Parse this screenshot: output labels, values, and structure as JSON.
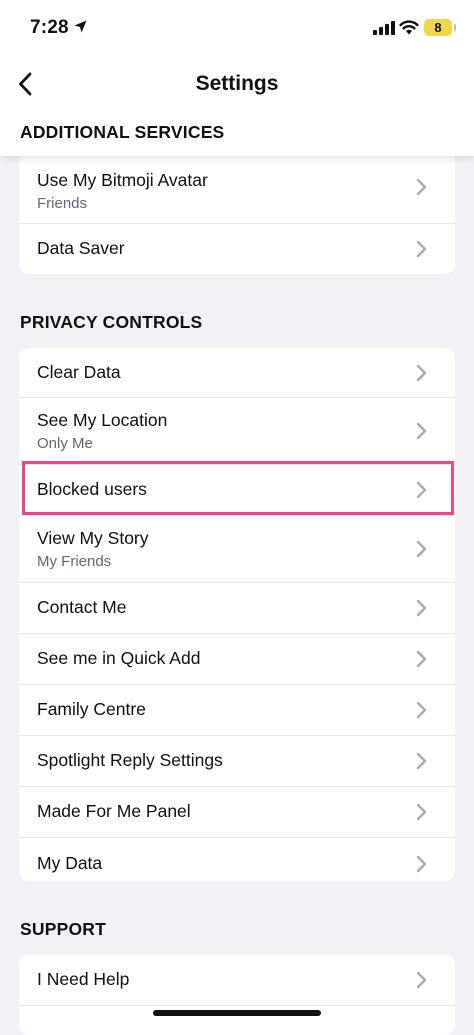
{
  "status_bar": {
    "time": "7:28",
    "battery": "8"
  },
  "header": {
    "title": "Settings",
    "sticky_section": "ADDITIONAL SERVICES"
  },
  "additional_services": {
    "items": [
      {
        "label": "Use My Bitmoji Avatar",
        "sub": "Friends"
      },
      {
        "label": "Data Saver"
      }
    ]
  },
  "privacy": {
    "header": "PRIVACY CONTROLS",
    "items": [
      {
        "label": "Clear Data"
      },
      {
        "label": "See My Location",
        "sub": "Only Me"
      },
      {
        "label": "Blocked users"
      },
      {
        "label": "View My Story",
        "sub": "My Friends"
      },
      {
        "label": "Contact Me"
      },
      {
        "label": "See me in Quick Add"
      },
      {
        "label": "Family Centre"
      },
      {
        "label": "Spotlight Reply Settings"
      },
      {
        "label": "Made For Me Panel"
      },
      {
        "label": "My Data"
      }
    ]
  },
  "support": {
    "header": "SUPPORT",
    "items": [
      {
        "label": "I Need Help"
      }
    ]
  },
  "colors": {
    "highlight": "#f0458a",
    "accent_battery": "#f2d648"
  }
}
